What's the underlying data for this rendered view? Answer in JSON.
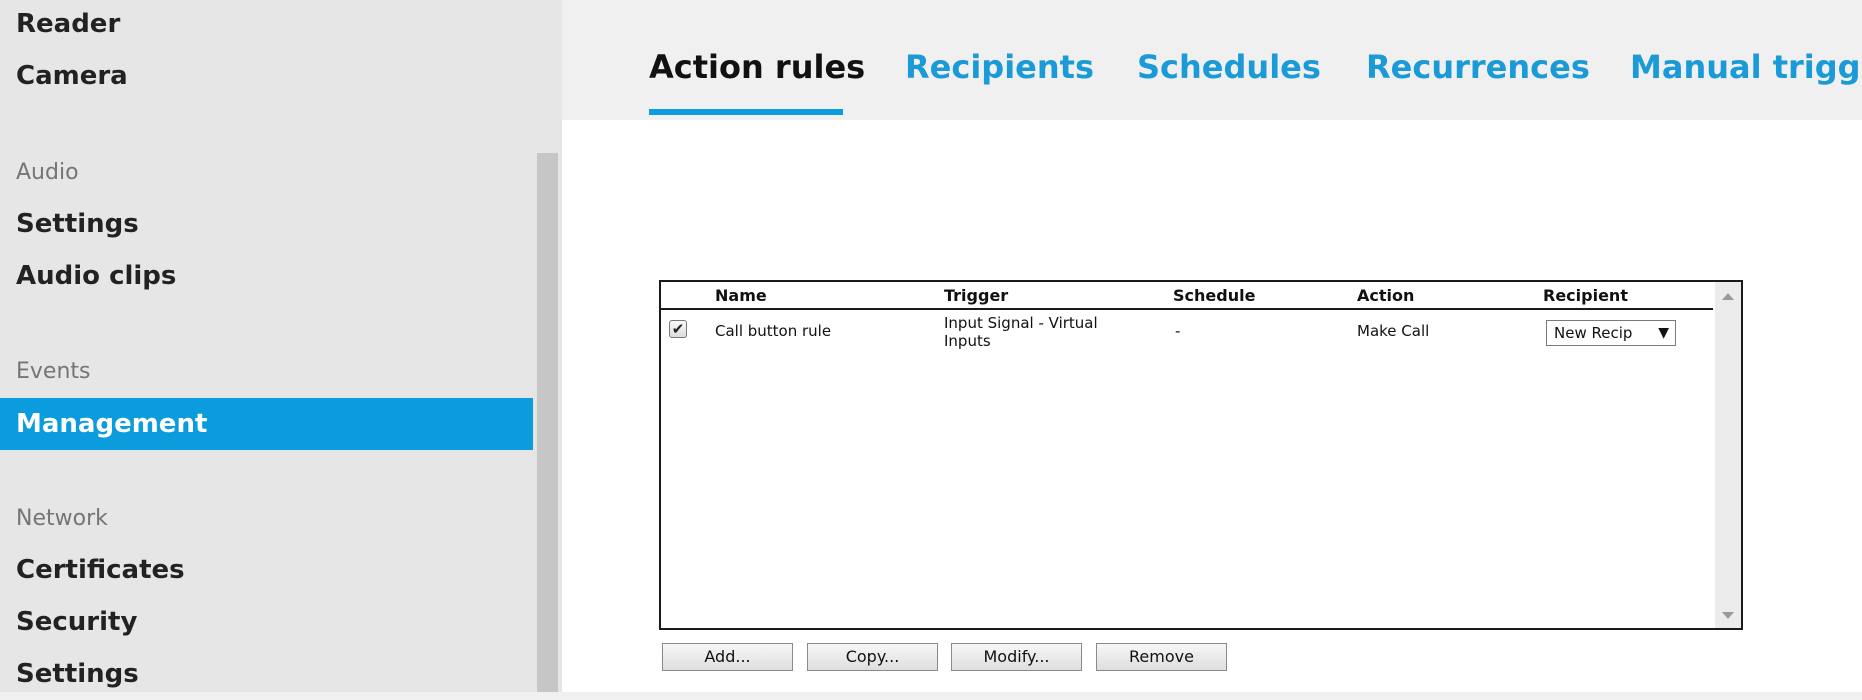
{
  "sidebar": {
    "items_top": [
      "Reader",
      "Camera"
    ],
    "audio_section": "Audio",
    "audio_items": [
      "Settings",
      "Audio clips"
    ],
    "events_section": "Events",
    "events_items": [
      "Management"
    ],
    "network_section": "Network",
    "network_items": [
      "Certificates",
      "Security",
      "Settings"
    ]
  },
  "tabs": [
    "Action rules",
    "Recipients",
    "Schedules",
    "Recurrences",
    "Manual trigger"
  ],
  "active_tab": "Action rules",
  "table": {
    "headers": [
      "Name",
      "Trigger",
      "Schedule",
      "Action",
      "Recipient"
    ],
    "rows": [
      {
        "enabled": "✔",
        "name": "Call button rule",
        "trigger": "Input Signal - Virtual Inputs",
        "schedule": "-",
        "action": "Make Call",
        "recipient": "New Recip"
      }
    ]
  },
  "buttons": {
    "add": "Add...",
    "copy": "Copy...",
    "modify": "Modify...",
    "remove": "Remove"
  },
  "colors": {
    "accent": "#0a9cdc",
    "tab_link": "#1a9ad6"
  }
}
